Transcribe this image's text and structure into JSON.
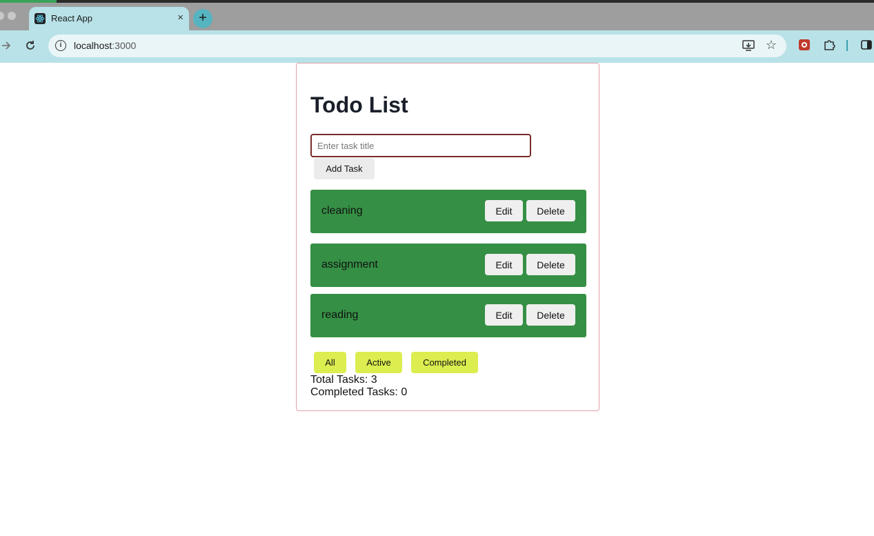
{
  "browser": {
    "tab_title": "React App",
    "tab_close": "×",
    "new_tab": "+",
    "url_host": "localhost",
    "url_port": ":3000",
    "icons": [
      "react-icon",
      "back-icon",
      "forward-icon",
      "reload-icon",
      "info-icon",
      "install-icon",
      "star-icon",
      "extension-icon",
      "puzzle-icon",
      "side-panel-icon"
    ]
  },
  "app": {
    "title": "Todo List",
    "input_placeholder": "Enter task title",
    "input_value": "",
    "add_label": "Add Task",
    "tasks": [
      {
        "title": "cleaning",
        "edit": "Edit",
        "delete": "Delete"
      },
      {
        "title": "assignment",
        "edit": "Edit",
        "delete": "Delete"
      },
      {
        "title": "reading",
        "edit": "Edit",
        "delete": "Delete"
      }
    ],
    "filters": [
      "All",
      "Active",
      "Completed"
    ],
    "total_tasks": "Total Tasks: 3",
    "completed_tasks": "Completed Tasks: 0"
  },
  "colors": {
    "task_bg": "#358f44",
    "filter_bg": "#dced4f",
    "card_border": "#e0a0aa",
    "input_border": "#7a2a2a",
    "browser_chrome": "#b8e2e8"
  }
}
